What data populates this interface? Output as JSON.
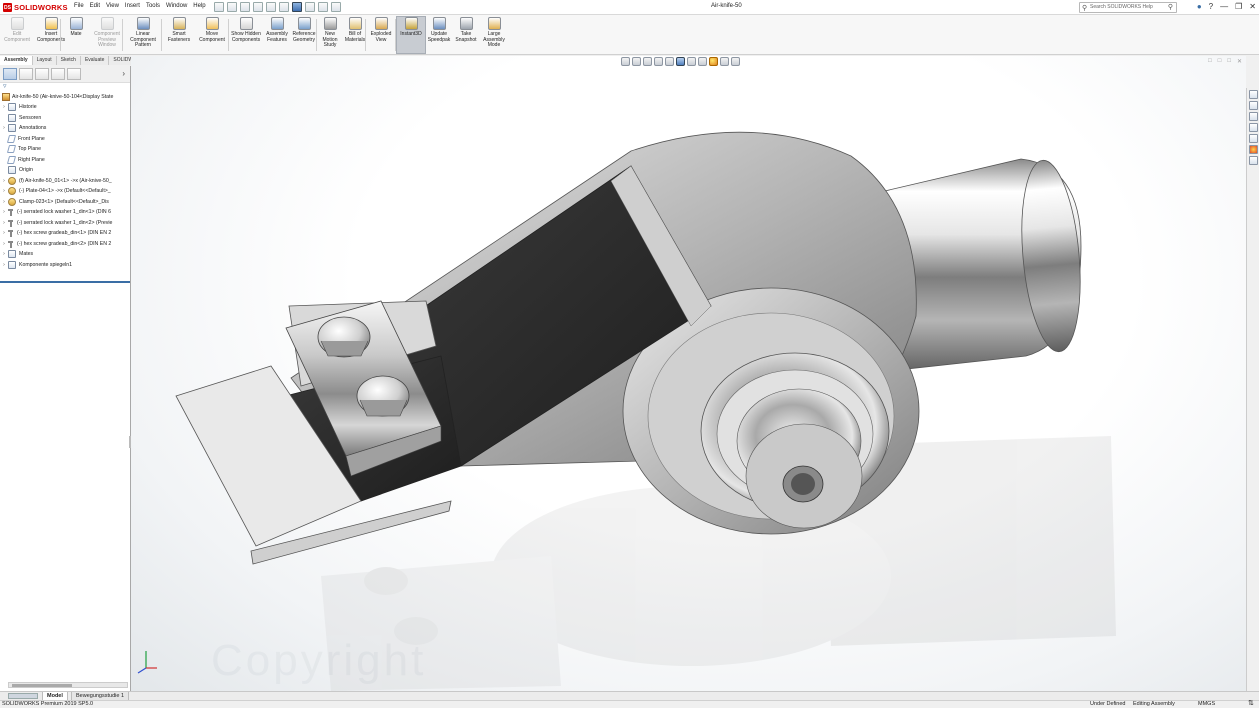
{
  "app": {
    "brand": "SOLIDWORKS",
    "doc_title": "Air-knife-50",
    "search_placeholder": "Search SOLIDWORKS Help"
  },
  "menu": [
    "File",
    "Edit",
    "View",
    "Insert",
    "Tools",
    "Window",
    "Help"
  ],
  "commands": [
    {
      "label": "Edit Component",
      "disabled": true
    },
    {
      "label": "Insert Components",
      "disabled": false
    },
    {
      "label": "Mate",
      "disabled": false
    },
    {
      "label": "Component Preview Window",
      "disabled": true
    },
    {
      "label": "Linear Component Pattern",
      "disabled": false
    },
    {
      "label": "Smart Fasteners",
      "disabled": false
    },
    {
      "label": "Move Component",
      "disabled": false
    },
    {
      "label": "Show Hidden Components",
      "disabled": false
    },
    {
      "label": "Assembly Features",
      "disabled": false
    },
    {
      "label": "Reference Geometry",
      "disabled": false
    },
    {
      "label": "New Motion Study",
      "disabled": false
    },
    {
      "label": "Bill of Materials",
      "disabled": false
    },
    {
      "label": "Exploded View",
      "disabled": false
    },
    {
      "label": "Instant3D",
      "disabled": false,
      "active": true
    },
    {
      "label": "Update Speedpak",
      "disabled": false
    },
    {
      "label": "Take Snapshot",
      "disabled": false
    },
    {
      "label": "Large Assembly Mode",
      "disabled": false
    }
  ],
  "cmd_tabs": [
    "Assembly",
    "Layout",
    "Sketch",
    "Evaluate",
    "SOLIDWORKS Add-Ins"
  ],
  "tree": {
    "root": "Air-knife-50  (Air-knive-50-104<Display State",
    "items": [
      {
        "label": "Historie",
        "icon": "history-icon",
        "expand": true
      },
      {
        "label": "Sensoren",
        "icon": "sensor-icon",
        "expand": false
      },
      {
        "label": "Annotations",
        "icon": "annotation-icon",
        "expand": true
      },
      {
        "label": "Front Plane",
        "icon": "plane-icon",
        "expand": false
      },
      {
        "label": "Top Plane",
        "icon": "plane-icon",
        "expand": false
      },
      {
        "label": "Right Plane",
        "icon": "plane-icon",
        "expand": false
      },
      {
        "label": "Origin",
        "icon": "origin-icon",
        "expand": false
      },
      {
        "label": "(f) Air-knife-50_01<1> ->x (Air-knive-50_",
        "icon": "part-icon",
        "expand": true
      },
      {
        "label": "(-) Plate-04<1> ->x (Default<<Default>_",
        "icon": "part-icon",
        "expand": true
      },
      {
        "label": "Clamp-023<1> (Default<<Default>_Dis",
        "icon": "part-icon",
        "expand": true
      },
      {
        "label": "(-) serrated lock washer 1_din<1> (DIN 6",
        "icon": "screw-icon",
        "expand": true
      },
      {
        "label": "(-) serrated lock washer 1_din<2> (Previe",
        "icon": "screw-icon",
        "expand": true
      },
      {
        "label": "(-) hex screw gradeab_din<1> (DIN EN 2",
        "icon": "screw-icon",
        "expand": true
      },
      {
        "label": "(-) hex screw gradeab_din<2> (DIN EN 2",
        "icon": "screw-icon",
        "expand": true
      },
      {
        "label": "Mates",
        "icon": "mates-icon",
        "expand": true
      },
      {
        "label": "Komponente spiegeln1",
        "icon": "mirror-icon",
        "expand": true
      }
    ]
  },
  "bottom_tabs": [
    "Model",
    "Bewegungsstudie 1"
  ],
  "status": {
    "version": "SOLIDWORKS Premium 2019 SP5.0",
    "state": "Under Defined",
    "mode": "Editing Assembly",
    "units": "MMGS"
  },
  "watermark": "Copyright",
  "colors": {
    "brand": "#d40000",
    "selection": "#3a6ea5"
  }
}
